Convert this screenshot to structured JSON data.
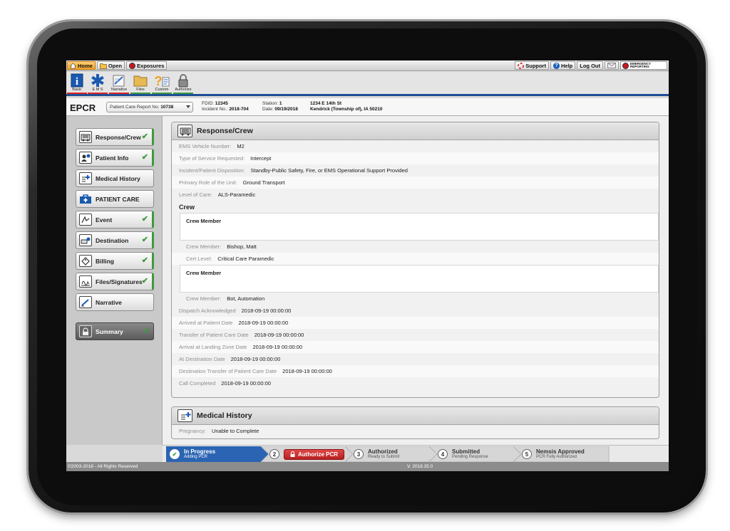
{
  "menubar": {
    "left": [
      {
        "label": "Home",
        "active": true
      },
      {
        "label": "Open",
        "active": false
      },
      {
        "label": "Exposures",
        "active": false
      }
    ],
    "right": [
      {
        "label": "Support"
      },
      {
        "label": "Help"
      },
      {
        "label": "Log Out"
      }
    ],
    "logo_text_1": "EMERGENCY",
    "logo_text_2": "REPORTING"
  },
  "toolbar": [
    {
      "label": "Basic",
      "color": "#d22"
    },
    {
      "label": "E M S",
      "color": "#d22"
    },
    {
      "label": "Narrative",
      "color": "#d22"
    },
    {
      "label": "Files",
      "color": "#3d9a3d"
    },
    {
      "label": "Custom",
      "color": "#3d9a3d"
    },
    {
      "label": "Authorize",
      "color": "#3d9a3d"
    }
  ],
  "header": {
    "title": "EPCR",
    "pcr_label": "Patient Care Report No:",
    "pcr_no": "10738",
    "fdid_label": "FDID:",
    "fdid": "12345",
    "incident_label": "Incident No.:",
    "incident": "2018-704",
    "station_label": "Station:",
    "station": "1",
    "date_label": "Date:",
    "date": "09/19/2018",
    "address1": "1234 E 14th St",
    "address2": "Kendrick (Township of), IA 50210"
  },
  "sidebar": [
    {
      "label": "Response/Crew",
      "done": true
    },
    {
      "label": "Patient Info",
      "done": true
    },
    {
      "label": "Medical History",
      "done": false
    },
    {
      "label": "PATIENT CARE",
      "done": false
    },
    {
      "label": "Event",
      "done": true
    },
    {
      "label": "Destination",
      "done": true
    },
    {
      "label": "Billing",
      "done": true
    },
    {
      "label": "Files/Signatures",
      "done": true
    },
    {
      "label": "Narrative",
      "done": false
    },
    {
      "label": "Summary",
      "done": true
    }
  ],
  "response": {
    "title": "Response/Crew",
    "fields": [
      {
        "k": "EMS Vehicle Number:",
        "v": "M2"
      },
      {
        "k": "Type of Service Requested:",
        "v": "Intercept"
      },
      {
        "k": "Incident/Patient Disposition:",
        "v": "Standby-Public Safety, Fire, or EMS Operational Support Provided"
      },
      {
        "k": "Primary Role of the Unit:",
        "v": "Ground Transport"
      },
      {
        "k": "Level of Care:",
        "v": "ALS-Paramedic"
      }
    ],
    "crew_title": "Crew",
    "crew_member_title": "Crew Member",
    "crew1": [
      {
        "k": "Crew Member:",
        "v": "Bishop, Matt"
      },
      {
        "k": "Cert Level:",
        "v": "Critical Care Paramedic"
      }
    ],
    "crew2": [
      {
        "k": "Crew Member:",
        "v": "Bot, Automation"
      }
    ],
    "times": [
      {
        "k": "Dispatch Acknowledged",
        "v": "2018-09-19 00:00:00"
      },
      {
        "k": "Arrived at Patient Date",
        "v": "2018-09-19 00:00:00"
      },
      {
        "k": "Transfer of Patient Care Date",
        "v": "2018-09-19 00:00:00"
      },
      {
        "k": "Arrival at Landing Zone Date",
        "v": "2018-09-19 00:00:00"
      },
      {
        "k": "At Destination Date",
        "v": "2018-09-19 00:00:00"
      },
      {
        "k": "Destination Transfer of Patient Care Date",
        "v": "2018-09-19 00:00:00"
      },
      {
        "k": "Call Completed",
        "v": "2018-09-19 00:00:00"
      }
    ]
  },
  "medical": {
    "title": "Medical History",
    "fields": [
      {
        "k": "Pregnancy:",
        "v": "Unable to Complete"
      }
    ]
  },
  "status": {
    "step1_title": "In Progress",
    "step1_sub": "Adding PCR",
    "step2_num": "2",
    "step2_btn": "Authorize PCR",
    "step3_num": "3",
    "step3_title": "Authorized",
    "step3_sub": "Ready to Submit",
    "step4_num": "4",
    "step4_title": "Submitted",
    "step4_sub": "Pending Response",
    "step5_num": "5",
    "step5_title": "Nemsis Approved",
    "step5_sub": "PCR Fully Authorized"
  },
  "footer": {
    "copyright": "©2003-2018 - All Rights Reserved",
    "version": "V. 2018.35.0"
  }
}
